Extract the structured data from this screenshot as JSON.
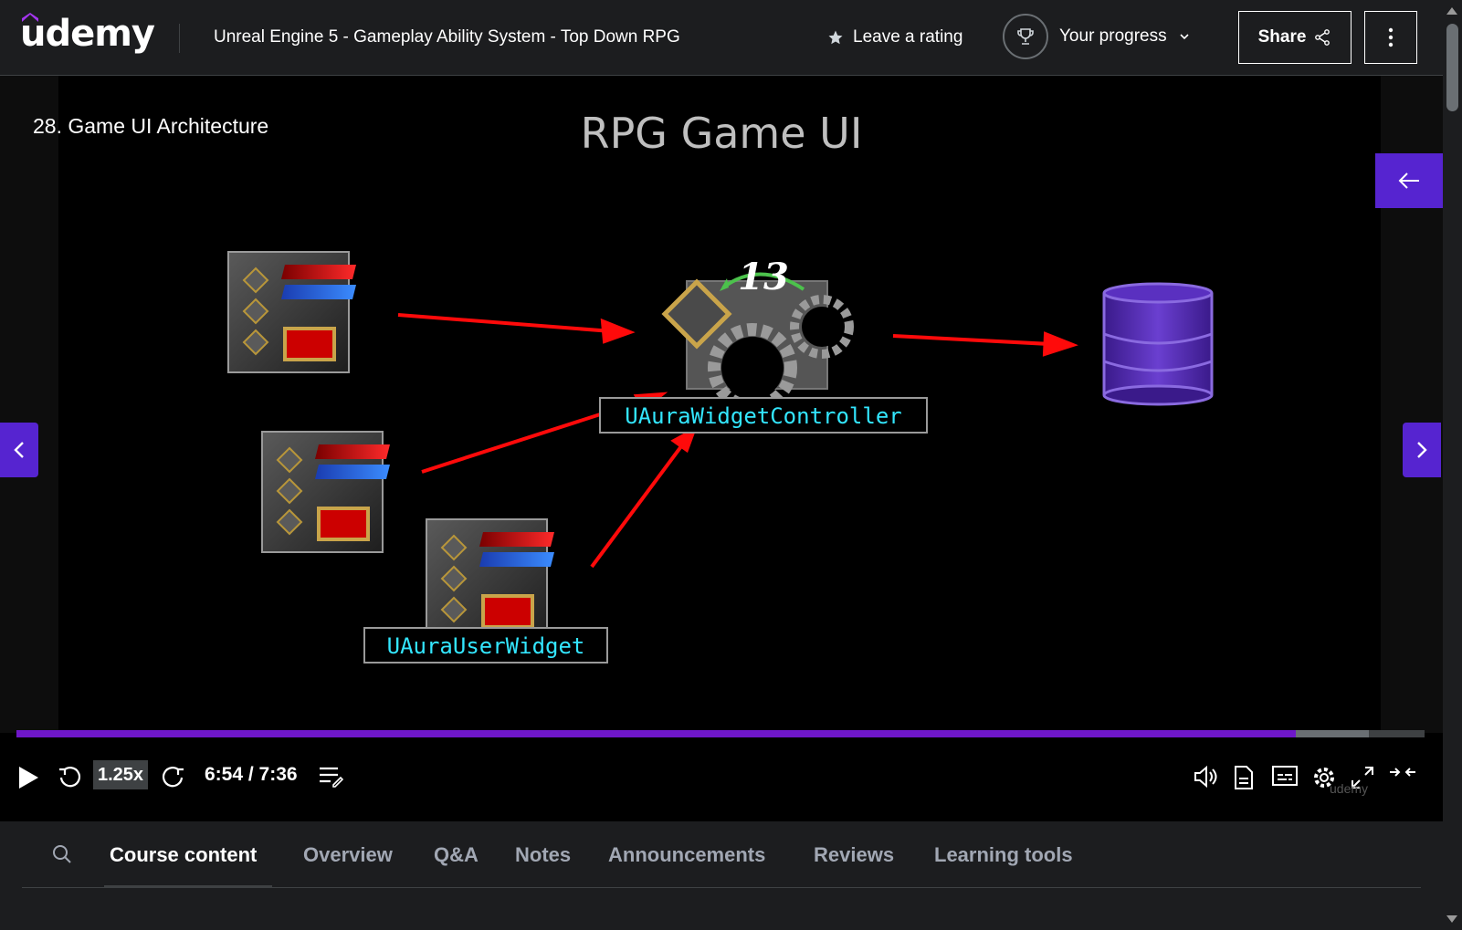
{
  "header": {
    "logo_text": "udemy",
    "course_title": "Unreal Engine 5 - Gameplay Ability System - Top Down RPG",
    "rating_label": "Leave a rating",
    "progress_label": "Your progress",
    "share_label": "Share"
  },
  "video": {
    "lecture_title": "28. Game UI Architecture",
    "slide_title": "RPG Game UI",
    "badge_number": "13",
    "controller_label": "UAuraWidgetController",
    "widget_label": "UAuraUserWidget",
    "playback_speed": "1.25x",
    "time_display": "6:54 / 7:36",
    "progress_fraction": 0.9084,
    "buffered_fraction": 0.9605,
    "watermark": "udemy"
  },
  "tabs": [
    {
      "label": "Course content",
      "active": true
    },
    {
      "label": "Overview",
      "active": false
    },
    {
      "label": "Q&A",
      "active": false
    },
    {
      "label": "Notes",
      "active": false
    },
    {
      "label": "Announcements",
      "active": false
    },
    {
      "label": "Reviews",
      "active": false
    },
    {
      "label": "Learning tools",
      "active": false
    }
  ],
  "colors": {
    "brand_purple": "#5624d0",
    "progress_purple": "#6f17c9",
    "label_cyan": "#33e6ff",
    "arrow_red": "#ff0a0a"
  },
  "icons": [
    "star-icon",
    "trophy-icon",
    "chevron-down-icon",
    "share-icon",
    "more-vertical-icon",
    "arrow-left-icon",
    "chevron-left-icon",
    "chevron-right-icon",
    "play-icon",
    "rewind-icon",
    "forward-icon",
    "notes-icon",
    "volume-icon",
    "transcript-icon",
    "captions-icon",
    "settings-icon",
    "fullscreen-icon",
    "collapse-icon",
    "search-icon"
  ]
}
